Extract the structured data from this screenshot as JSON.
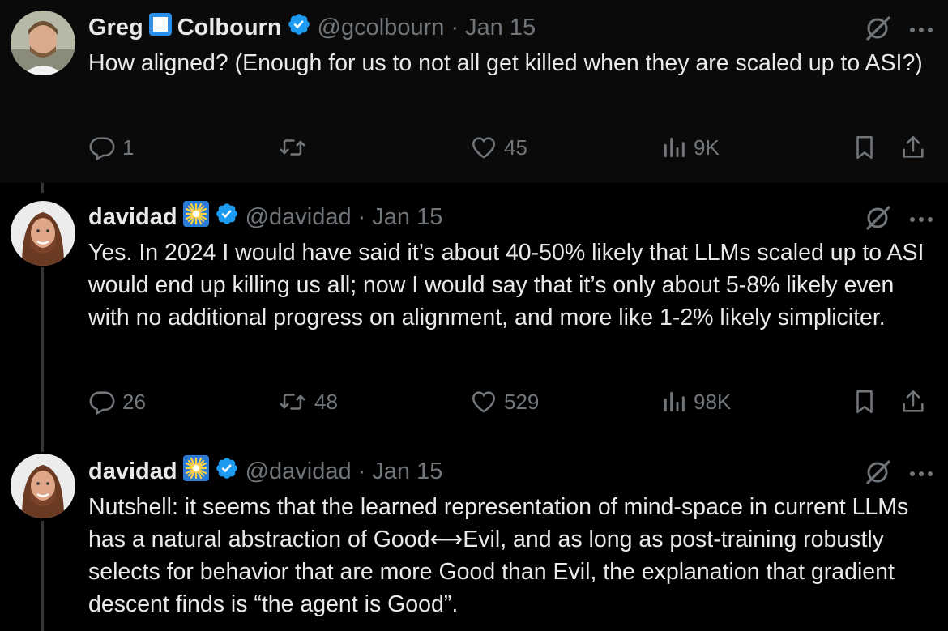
{
  "tweets": [
    {
      "name_first": "Greg",
      "name_last": "Colbourn",
      "handle": "@gcolbourn",
      "date": "Jan 15",
      "text": "How aligned? (Enough for us to not all get killed when they are scaled up to ASI?)",
      "replies": "1",
      "retweets": "",
      "likes": "45",
      "views": "9K"
    },
    {
      "name": "davidad",
      "handle": "@davidad",
      "date": "Jan 15",
      "text": "Yes. In 2024 I would have said it’s about 40-50% likely that LLMs scaled up to ASI would end up killing us all; now I would say that it’s only about 5-8% likely even with no additional progress on alignment, and more like 1-2% likely simpliciter.",
      "replies": "26",
      "retweets": "48",
      "likes": "529",
      "views": "98K"
    },
    {
      "name": "davidad",
      "handle": "@davidad",
      "date": "Jan 15",
      "text": "Nutshell: it seems that the learned representation of mind-space in current LLMs has a natural abstraction of Good⟷Evil, and as long as post-training robustly selects for behavior that are more Good than Evil, the explanation that gradient descent finds is “the agent is Good”."
    }
  ],
  "separator": "·",
  "icons": {
    "verified": "verified-badge-icon",
    "grok": "grok-icon",
    "more": "more-icon",
    "reply": "reply-icon",
    "retweet": "retweet-icon",
    "like": "heart-icon",
    "views": "views-icon",
    "bookmark": "bookmark-icon",
    "share": "share-icon"
  },
  "colors": {
    "background": "#000000",
    "text": "#e7e9ea",
    "muted": "#71767b",
    "verified": "#1d9bf0"
  }
}
